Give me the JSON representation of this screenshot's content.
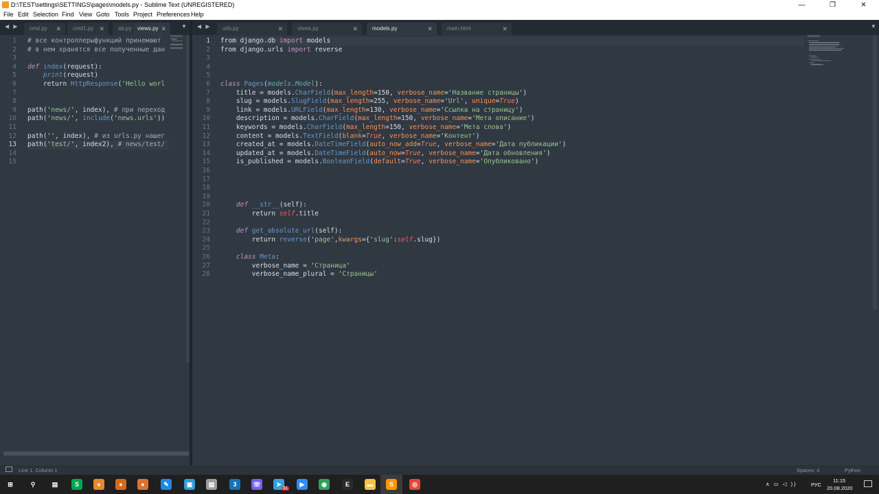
{
  "window": {
    "title": "D:\\TEST\\settings\\SETTINGS\\pages\\models.py - Sublime Text (UNREGISTERED)",
    "minimize": "—",
    "restore": "❐",
    "close": "✕"
  },
  "menu": [
    "File",
    "Edit",
    "Selection",
    "Find",
    "View",
    "Goto",
    "Tools",
    "Project",
    "Preferences",
    "Help"
  ],
  "left_tabs": [
    {
      "label": "cmd.py",
      "close": "✕"
    },
    {
      "label": "cmd1.py",
      "close": "✕"
    },
    {
      "label": "ab.py",
      "close": "✕"
    },
    {
      "label": "views.py",
      "close": "✕"
    }
  ],
  "right_tabs": [
    {
      "label": "urls.py",
      "close": "✕"
    },
    {
      "label": "views.py",
      "close": "✕"
    },
    {
      "label": "models.py",
      "close": "✕"
    },
    {
      "label": "main.html",
      "close": "✕"
    }
  ],
  "nav_arrows": "◀ ▶",
  "dropdown_arrow": "▼",
  "left_pane": {
    "line_numbers": [
      "1",
      "2",
      "3",
      "4",
      "5",
      "6",
      "7",
      "8",
      "9",
      "10",
      "11",
      "12",
      "13",
      "14",
      "15"
    ],
    "current_line": "13",
    "lines": [
      [
        {
          "t": "# все контроллерыфункций принемают",
          "c": "c"
        }
      ],
      [
        {
          "t": "# в нем хранятся все полученные дан",
          "c": "c"
        }
      ],
      [],
      [
        {
          "t": "def ",
          "c": "k it"
        },
        {
          "t": "index",
          "c": "f"
        },
        {
          "t": "(request):",
          "c": ""
        }
      ],
      [
        {
          "t": "    ",
          "c": ""
        },
        {
          "t": "print",
          "c": "f it"
        },
        {
          "t": "(request)",
          "c": ""
        }
      ],
      [
        {
          "t": "    return ",
          "c": ""
        },
        {
          "t": "HttpResponse",
          "c": "f"
        },
        {
          "t": "('",
          "c": ""
        },
        {
          "t": "Hello worl",
          "c": "s"
        }
      ],
      [],
      [],
      [
        {
          "t": "path",
          "c": ""
        },
        {
          "t": "('",
          "c": ""
        },
        {
          "t": "news/",
          "c": "s"
        },
        {
          "t": "', index), ",
          "c": ""
        },
        {
          "t": "# при переход",
          "c": "c"
        }
      ],
      [
        {
          "t": "path",
          "c": ""
        },
        {
          "t": "('",
          "c": ""
        },
        {
          "t": "news/",
          "c": "s"
        },
        {
          "t": "', ",
          "c": ""
        },
        {
          "t": "include",
          "c": "f"
        },
        {
          "t": "('",
          "c": ""
        },
        {
          "t": "news.urls",
          "c": "s"
        },
        {
          "t": "'))",
          "c": ""
        }
      ],
      [],
      [
        {
          "t": "path",
          "c": ""
        },
        {
          "t": "('', index), ",
          "c": ""
        },
        {
          "t": "# из urls.py нашег",
          "c": "c"
        }
      ],
      [
        {
          "t": "path",
          "c": ""
        },
        {
          "t": "('",
          "c": ""
        },
        {
          "t": "test/",
          "c": "s"
        },
        {
          "t": "', index2), ",
          "c": ""
        },
        {
          "t": "# news/test/",
          "c": "c"
        }
      ],
      [],
      []
    ]
  },
  "right_pane": {
    "line_numbers": [
      "1",
      "2",
      "3",
      "4",
      "5",
      "6",
      "7",
      "8",
      "9",
      "10",
      "11",
      "12",
      "13",
      "14",
      "15",
      "16",
      "17",
      "18",
      "19",
      "20",
      "21",
      "22",
      "23",
      "24",
      "25",
      "26",
      "27",
      "28"
    ],
    "current_line": "1",
    "lines": [
      [
        {
          "t": "from ",
          "c": ""
        },
        {
          "t": "django.db",
          "c": ""
        },
        {
          "t": " import ",
          "c": "k"
        },
        {
          "t": "models",
          "c": ""
        }
      ],
      [
        {
          "t": "from ",
          "c": ""
        },
        {
          "t": "django.urls",
          "c": ""
        },
        {
          "t": " import ",
          "c": "k"
        },
        {
          "t": "reverse",
          "c": ""
        }
      ],
      [],
      [],
      [],
      [
        {
          "t": "class ",
          "c": "k it"
        },
        {
          "t": "Pages",
          "c": "f"
        },
        {
          "t": "(",
          "c": ""
        },
        {
          "t": "models.Model",
          "c": "i it"
        },
        {
          "t": "):",
          "c": ""
        }
      ],
      [
        {
          "t": "    title = models.",
          "c": ""
        },
        {
          "t": "CharField",
          "c": "f"
        },
        {
          "t": "(",
          "c": ""
        },
        {
          "t": "max_length",
          "c": "v"
        },
        {
          "t": "=150, ",
          "c": ""
        },
        {
          "t": "verbose_name",
          "c": "v"
        },
        {
          "t": "='",
          "c": ""
        },
        {
          "t": "Название страницы",
          "c": "s"
        },
        {
          "t": "')",
          "c": ""
        }
      ],
      [
        {
          "t": "    slug = models.",
          "c": ""
        },
        {
          "t": "SlugField",
          "c": "f"
        },
        {
          "t": "(",
          "c": ""
        },
        {
          "t": "max_length",
          "c": "v"
        },
        {
          "t": "=255, ",
          "c": ""
        },
        {
          "t": "verbose_name",
          "c": "v"
        },
        {
          "t": "='",
          "c": ""
        },
        {
          "t": "Url",
          "c": "s"
        },
        {
          "t": "', ",
          "c": ""
        },
        {
          "t": "unique",
          "c": "v"
        },
        {
          "t": "=",
          "c": ""
        },
        {
          "t": "True",
          "c": "o it"
        },
        {
          "t": ")",
          "c": ""
        }
      ],
      [
        {
          "t": "    link = models.",
          "c": ""
        },
        {
          "t": "URLField",
          "c": "f"
        },
        {
          "t": "(",
          "c": ""
        },
        {
          "t": "max_length",
          "c": "v"
        },
        {
          "t": "=130, ",
          "c": ""
        },
        {
          "t": "verbose_name",
          "c": "v"
        },
        {
          "t": "='",
          "c": ""
        },
        {
          "t": "Ссылка на страницу",
          "c": "s"
        },
        {
          "t": "')",
          "c": ""
        }
      ],
      [
        {
          "t": "    description = models.",
          "c": ""
        },
        {
          "t": "CharField",
          "c": "f"
        },
        {
          "t": "(",
          "c": ""
        },
        {
          "t": "max_length",
          "c": "v"
        },
        {
          "t": "=150, ",
          "c": ""
        },
        {
          "t": "verbose_name",
          "c": "v"
        },
        {
          "t": "='",
          "c": ""
        },
        {
          "t": "Мета описание",
          "c": "s"
        },
        {
          "t": "')",
          "c": ""
        }
      ],
      [
        {
          "t": "    keywords = models.",
          "c": ""
        },
        {
          "t": "CharField",
          "c": "f"
        },
        {
          "t": "(",
          "c": ""
        },
        {
          "t": "max_length",
          "c": "v"
        },
        {
          "t": "=150, ",
          "c": ""
        },
        {
          "t": "verbose_name",
          "c": "v"
        },
        {
          "t": "='",
          "c": ""
        },
        {
          "t": "Мета слова",
          "c": "s"
        },
        {
          "t": "')",
          "c": ""
        }
      ],
      [
        {
          "t": "    content = models.",
          "c": ""
        },
        {
          "t": "TextField",
          "c": "f"
        },
        {
          "t": "(",
          "c": ""
        },
        {
          "t": "blank",
          "c": "v"
        },
        {
          "t": "=",
          "c": ""
        },
        {
          "t": "True",
          "c": "o it"
        },
        {
          "t": ", ",
          "c": ""
        },
        {
          "t": "verbose_name",
          "c": "v"
        },
        {
          "t": "='",
          "c": ""
        },
        {
          "t": "Контент",
          "c": "s"
        },
        {
          "t": "')",
          "c": ""
        }
      ],
      [
        {
          "t": "    created_at = models.",
          "c": ""
        },
        {
          "t": "DateTimeField",
          "c": "f"
        },
        {
          "t": "(",
          "c": ""
        },
        {
          "t": "auto_now_add",
          "c": "v"
        },
        {
          "t": "=",
          "c": ""
        },
        {
          "t": "True",
          "c": "o it"
        },
        {
          "t": ", ",
          "c": ""
        },
        {
          "t": "verbose_name",
          "c": "v"
        },
        {
          "t": "='",
          "c": ""
        },
        {
          "t": "Дата публикации",
          "c": "s"
        },
        {
          "t": "')",
          "c": ""
        }
      ],
      [
        {
          "t": "    updated_at = models.",
          "c": ""
        },
        {
          "t": "DateTimeField",
          "c": "f"
        },
        {
          "t": "(",
          "c": ""
        },
        {
          "t": "auto_now",
          "c": "v"
        },
        {
          "t": "=",
          "c": ""
        },
        {
          "t": "True",
          "c": "o it"
        },
        {
          "t": ", ",
          "c": ""
        },
        {
          "t": "verbose_name",
          "c": "v"
        },
        {
          "t": "='",
          "c": ""
        },
        {
          "t": "Дата обновления",
          "c": "s"
        },
        {
          "t": "')",
          "c": ""
        }
      ],
      [
        {
          "t": "    is_published = models.",
          "c": ""
        },
        {
          "t": "BooleanField",
          "c": "f"
        },
        {
          "t": "(",
          "c": ""
        },
        {
          "t": "default",
          "c": "v"
        },
        {
          "t": "=",
          "c": ""
        },
        {
          "t": "True",
          "c": "o it"
        },
        {
          "t": ", ",
          "c": ""
        },
        {
          "t": "verbose_name",
          "c": "v"
        },
        {
          "t": "='",
          "c": ""
        },
        {
          "t": "Опубликовано",
          "c": "s"
        },
        {
          "t": "')",
          "c": ""
        }
      ],
      [],
      [],
      [],
      [],
      [
        {
          "t": "    ",
          "c": ""
        },
        {
          "t": "def ",
          "c": "k it"
        },
        {
          "t": "__str__",
          "c": "f"
        },
        {
          "t": "(self):",
          "c": ""
        }
      ],
      [
        {
          "t": "        return ",
          "c": ""
        },
        {
          "t": "self",
          "c": "sf"
        },
        {
          "t": ".title",
          "c": ""
        }
      ],
      [],
      [
        {
          "t": "    ",
          "c": ""
        },
        {
          "t": "def ",
          "c": "k it"
        },
        {
          "t": "get_absolute_url",
          "c": "f"
        },
        {
          "t": "(self):",
          "c": ""
        }
      ],
      [
        {
          "t": "        return ",
          "c": ""
        },
        {
          "t": "reverse",
          "c": "f"
        },
        {
          "t": "('",
          "c": ""
        },
        {
          "t": "page",
          "c": "s"
        },
        {
          "t": "',",
          "c": ""
        },
        {
          "t": "kwargs",
          "c": "v"
        },
        {
          "t": "={'",
          "c": ""
        },
        {
          "t": "slug",
          "c": "s"
        },
        {
          "t": "':",
          "c": ""
        },
        {
          "t": "self",
          "c": "sf"
        },
        {
          "t": ".slug})",
          "c": ""
        }
      ],
      [],
      [
        {
          "t": "    ",
          "c": ""
        },
        {
          "t": "class ",
          "c": "k it"
        },
        {
          "t": "Meta",
          "c": "f"
        },
        {
          "t": ":",
          "c": ""
        }
      ],
      [
        {
          "t": "        verbose_name = '",
          "c": ""
        },
        {
          "t": "Страница",
          "c": "s"
        },
        {
          "t": "'",
          "c": ""
        }
      ],
      [
        {
          "t": "        verbose_name_plural = '",
          "c": ""
        },
        {
          "t": "Страницы",
          "c": "s"
        },
        {
          "t": "'",
          "c": ""
        }
      ]
    ]
  },
  "status": {
    "position": "Line 1, Column 1",
    "spaces": "Spaces: 4",
    "syntax": "Python"
  },
  "taskbar": {
    "lang": "РУС",
    "time": "11:15",
    "date": "20.08.2020",
    "badge": "31",
    "tray": "∧ ▭ ◁ ))",
    "icons": [
      {
        "name": "start-icon",
        "glyph": "⊞",
        "bg": "#1f1f1f"
      },
      {
        "name": "search-icon",
        "glyph": "⚲",
        "bg": "#1f1f1f"
      },
      {
        "name": "task-view-icon",
        "glyph": "▤",
        "bg": "#1f1f1f"
      },
      {
        "name": "skype-icon",
        "glyph": "S",
        "bg": "#00a651"
      },
      {
        "name": "cat-app-icon",
        "glyph": "●",
        "bg": "#e8892b"
      },
      {
        "name": "tiger-app-icon",
        "glyph": "●",
        "bg": "#d66a1c"
      },
      {
        "name": "tiger-app-2-icon",
        "glyph": "●",
        "bg": "#e0702a"
      },
      {
        "name": "pen-app-icon",
        "glyph": "✎",
        "bg": "#1e88e5"
      },
      {
        "name": "photo-app-icon",
        "glyph": "▣",
        "bg": "#2d9cdb"
      },
      {
        "name": "file-app-icon",
        "glyph": "▤",
        "bg": "#9e9e9e"
      },
      {
        "name": "css3-icon",
        "glyph": "3",
        "bg": "#1572b6"
      },
      {
        "name": "viber-icon",
        "glyph": "☏",
        "bg": "#7360f2"
      },
      {
        "name": "telegram-icon",
        "glyph": "➤",
        "bg": "#2ca5e0"
      },
      {
        "name": "zoom-icon",
        "glyph": "▶",
        "bg": "#2d8cff"
      },
      {
        "name": "green-app-icon",
        "glyph": "◉",
        "bg": "#2e9f5f"
      },
      {
        "name": "terminal-icon",
        "glyph": "E",
        "bg": "#2a2a2a"
      },
      {
        "name": "folder-icon",
        "glyph": "▬",
        "bg": "#f5c342"
      },
      {
        "name": "sublime-text-icon",
        "glyph": "S",
        "bg": "#ff9800"
      },
      {
        "name": "chrome-icon",
        "glyph": "◎",
        "bg": "#ea4335"
      }
    ]
  }
}
